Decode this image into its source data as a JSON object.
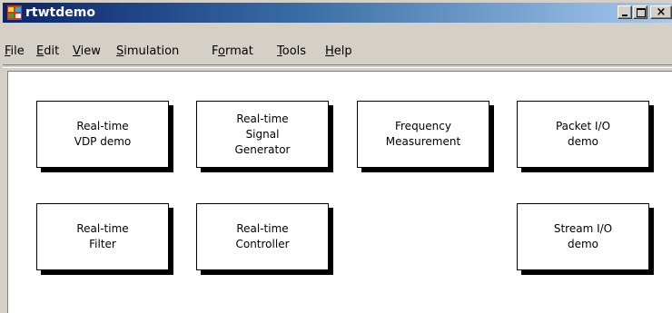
{
  "window": {
    "title": "rtwtdemo",
    "controls": {
      "minimize": "_",
      "maximize": "□",
      "close": "×"
    }
  },
  "menubar": {
    "items": [
      {
        "key": "F",
        "rest": "ile"
      },
      {
        "key": "E",
        "rest": "dit"
      },
      {
        "key": "V",
        "rest": "iew"
      },
      {
        "key": "S",
        "rest": "imulation"
      },
      {
        "pre": "F",
        "key": "o",
        "rest": "rmat"
      },
      {
        "key": "T",
        "rest": "ools"
      },
      {
        "key": "H",
        "rest": "elp"
      }
    ]
  },
  "blocks": [
    {
      "label": "Real-time\nVDP demo"
    },
    {
      "label": "Real-time\nSignal\nGenerator"
    },
    {
      "label": "Frequency\nMeasurement"
    },
    {
      "label": "Packet I/O\ndemo"
    },
    {
      "label": "Real-time\nFilter"
    },
    {
      "label": "Real-time\nController"
    },
    {
      "label": "Stream I/O\ndemo"
    }
  ]
}
